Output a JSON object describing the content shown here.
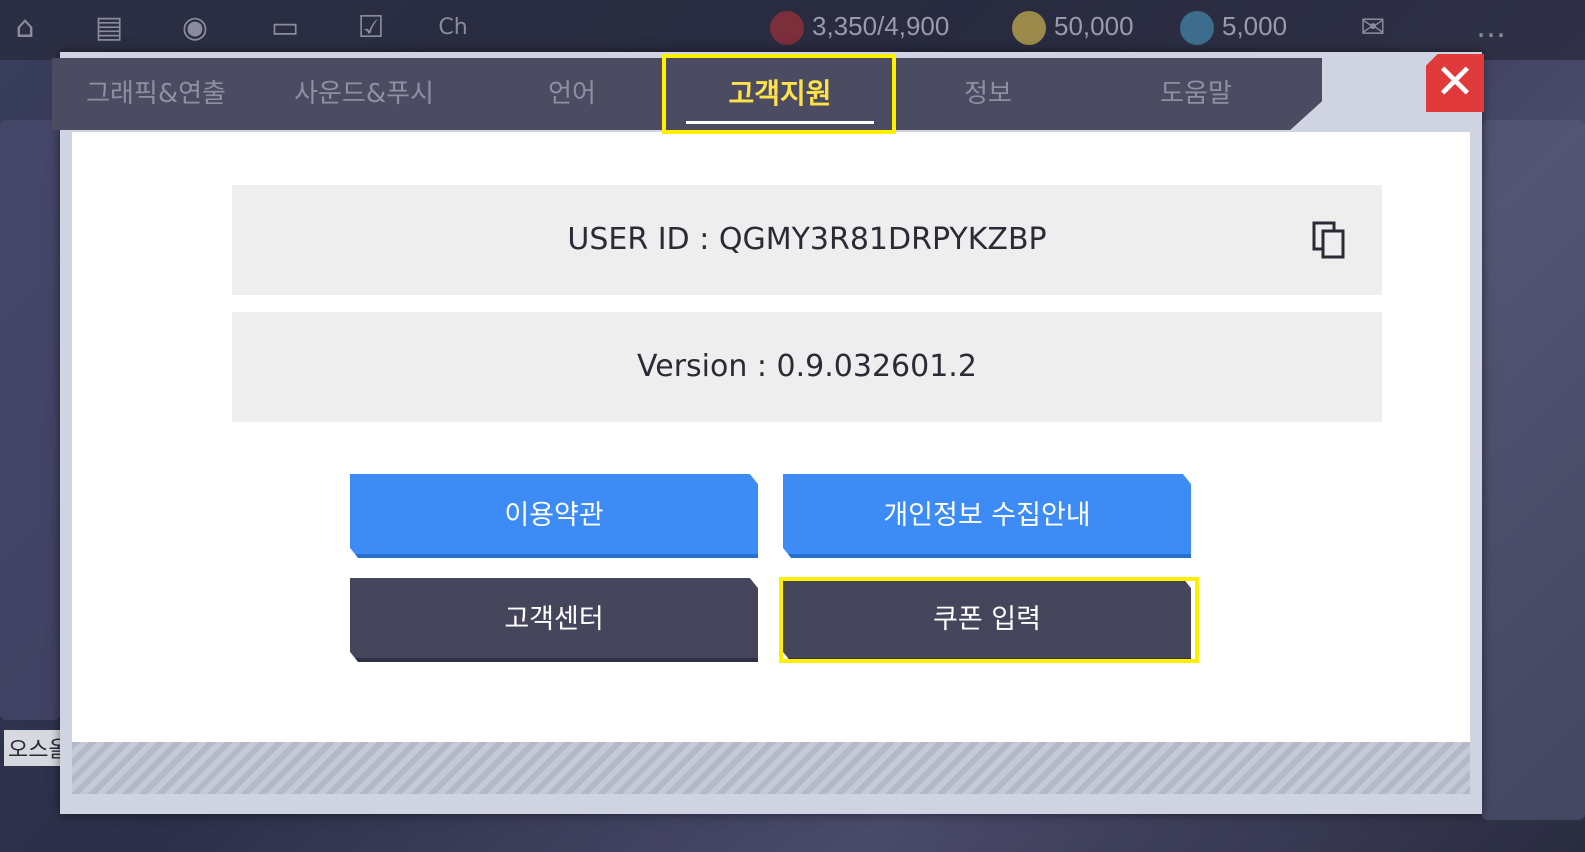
{
  "top_hud": {
    "stamina": "3,350/4,900",
    "gold": "50,000",
    "gems": "5,000"
  },
  "tabs": [
    {
      "label": "그래픽&연출"
    },
    {
      "label": "사운드&푸시"
    },
    {
      "label": "언어"
    },
    {
      "label": "고객지원"
    },
    {
      "label": "정보"
    },
    {
      "label": "도움말"
    }
  ],
  "active_tab": "고객지원",
  "user_id": "USER ID : QGMY3R81DRPYKZBP",
  "version": "Version : 0.9.032601.2",
  "buttons": {
    "terms": "이용약관",
    "privacy": "개인정보 수집안내",
    "support_center": "고객센터",
    "coupon": "쿠폰 입력"
  },
  "background_text": "오스올",
  "colors": {
    "accent_blue": "#3d8cf6",
    "dark_button": "#45465c",
    "highlight": "#ffef00",
    "close_red": "#e03a3a",
    "active_tab_text": "#ffe24a"
  }
}
